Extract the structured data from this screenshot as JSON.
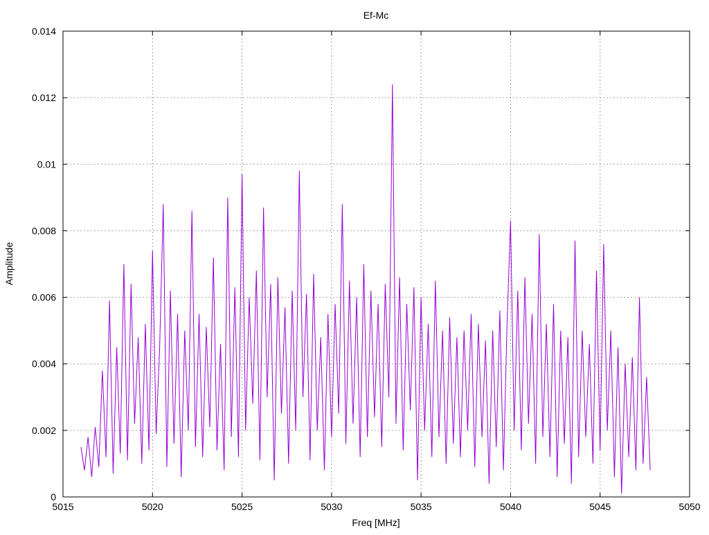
{
  "chart_data": {
    "type": "line",
    "title": "Ef-Mc",
    "xlabel": "Freq [MHz]",
    "ylabel": "Amplitude",
    "xlim": [
      5015,
      5050
    ],
    "ylim": [
      0,
      0.014
    ],
    "grid": true,
    "xticks": [
      5015,
      5020,
      5025,
      5030,
      5035,
      5040,
      5045,
      5050
    ],
    "xtick_labels": [
      "5015",
      "5020",
      "5025",
      "5030",
      "5035",
      "5040",
      "5045",
      "5050"
    ],
    "yticks": [
      0,
      0.002,
      0.004,
      0.006,
      0.008,
      0.01,
      0.012,
      0.014
    ],
    "ytick_labels": [
      "0",
      "0.002",
      "0.004",
      "0.006",
      "0.008",
      "0.01",
      "0.012",
      "0.014"
    ],
    "series": [
      {
        "name": "Ef-Mc",
        "color": "#9400d3",
        "x_start": 5016,
        "x_step": 0.2,
        "y": [
          0.0015,
          0.0008,
          0.0018,
          0.0006,
          0.0021,
          0.0009,
          0.0038,
          0.0012,
          0.0059,
          0.0007,
          0.0045,
          0.0013,
          0.007,
          0.0011,
          0.0064,
          0.0022,
          0.0048,
          0.001,
          0.0052,
          0.0014,
          0.0074,
          0.0019,
          0.0045,
          0.0088,
          0.0009,
          0.0062,
          0.0016,
          0.0055,
          0.0006,
          0.005,
          0.002,
          0.0086,
          0.0015,
          0.0055,
          0.0012,
          0.0051,
          0.0021,
          0.0072,
          0.0014,
          0.0046,
          0.0008,
          0.009,
          0.0018,
          0.0063,
          0.0012,
          0.0097,
          0.002,
          0.006,
          0.0028,
          0.0068,
          0.0011,
          0.0087,
          0.003,
          0.0064,
          0.0005,
          0.0066,
          0.0025,
          0.0057,
          0.001,
          0.0062,
          0.002,
          0.0098,
          0.003,
          0.0061,
          0.0011,
          0.0067,
          0.002,
          0.0048,
          0.0008,
          0.0055,
          0.0018,
          0.0058,
          0.0025,
          0.0088,
          0.0016,
          0.0065,
          0.0022,
          0.006,
          0.0012,
          0.007,
          0.0018,
          0.0062,
          0.0024,
          0.0058,
          0.0015,
          0.0064,
          0.003,
          0.0124,
          0.0022,
          0.0066,
          0.0014,
          0.0058,
          0.0026,
          0.0063,
          0.0005,
          0.006,
          0.002,
          0.0052,
          0.0012,
          0.0065,
          0.0018,
          0.005,
          0.001,
          0.0054,
          0.0016,
          0.0048,
          0.0012,
          0.005,
          0.002,
          0.0055,
          0.0009,
          0.0052,
          0.0018,
          0.0047,
          0.0004,
          0.005,
          0.0015,
          0.0056,
          0.0008,
          0.0052,
          0.0083,
          0.002,
          0.0062,
          0.0014,
          0.0066,
          0.0022,
          0.0055,
          0.001,
          0.0079,
          0.0018,
          0.0052,
          0.0012,
          0.0058,
          0.0006,
          0.005,
          0.0016,
          0.0048,
          0.0004,
          0.0077,
          0.0012,
          0.005,
          0.0018,
          0.0046,
          0.001,
          0.0068,
          0.0014,
          0.0076,
          0.002,
          0.005,
          0.0006,
          0.0045,
          0.0001,
          0.004,
          0.0012,
          0.0042,
          0.0008,
          0.006,
          0.001,
          0.0036,
          0.0008
        ]
      }
    ]
  }
}
